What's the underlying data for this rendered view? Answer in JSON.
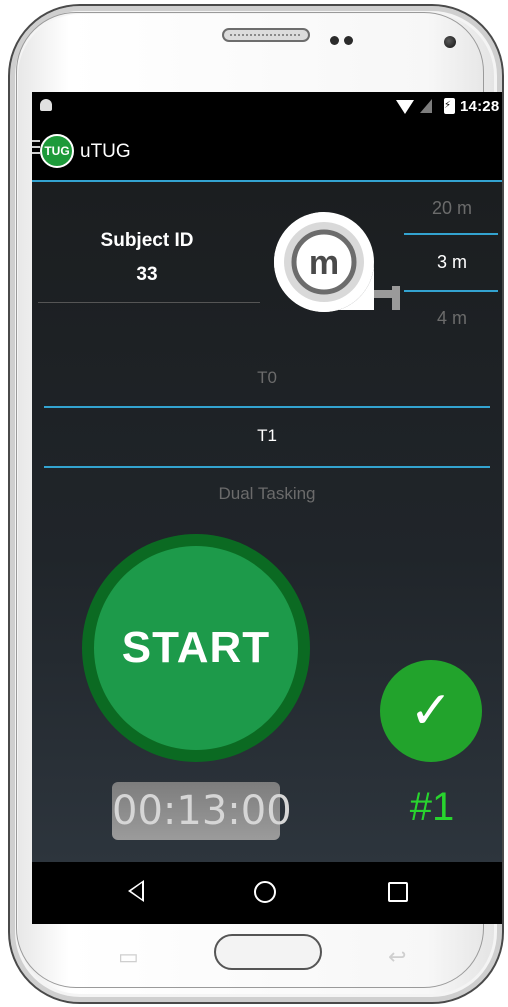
{
  "status_bar": {
    "time": "14:28",
    "icons": [
      "android-icon",
      "wifi-icon",
      "no-sim-icon",
      "battery-charging-icon"
    ]
  },
  "app": {
    "title": "uTUG",
    "logo_text": "TUG"
  },
  "subject": {
    "label": "Subject ID",
    "value": "33"
  },
  "distance_picker": {
    "options": [
      "20 m",
      "3 m",
      "4 m"
    ],
    "selected": "3 m"
  },
  "condition_picker": {
    "options": [
      "T0",
      "T1",
      "Dual Tasking"
    ],
    "selected": "T1"
  },
  "controls": {
    "start_label": "START",
    "timer": "00:13:00",
    "trial": "#1"
  },
  "colors": {
    "accent_line": "#33a3d0",
    "start_green": "#1d9a4a",
    "check_green": "#22a32c",
    "trial_green": "#28d42e"
  }
}
